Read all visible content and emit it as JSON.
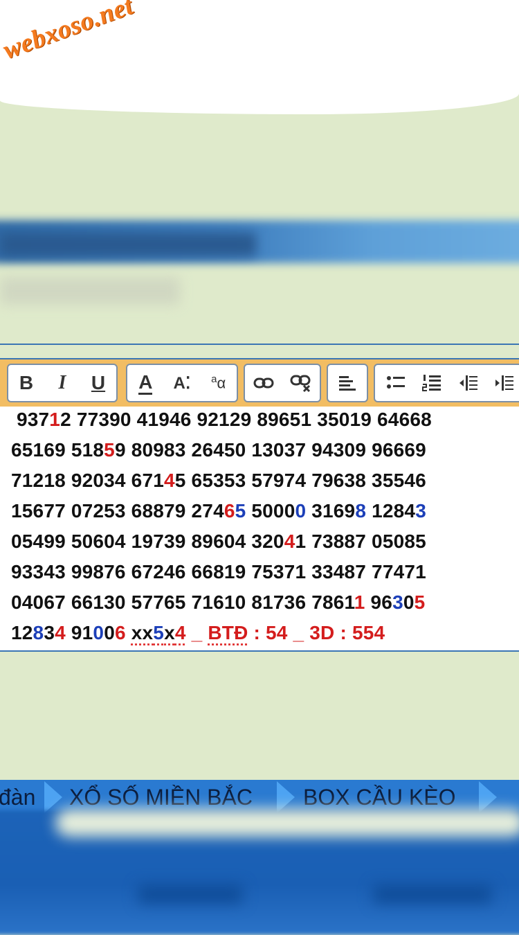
{
  "logo": {
    "text": "webxoso.net"
  },
  "toolbar": {
    "groups": [
      [
        "bold-icon",
        "italic-icon",
        "underline-icon"
      ],
      [
        "font-color-icon",
        "font-size-icon",
        "case-icon"
      ],
      [
        "link-icon",
        "unlink-icon"
      ],
      [
        "align-left-icon"
      ],
      [
        "bullet-list-icon",
        "numbered-list-icon",
        "outdent-icon",
        "indent-icon"
      ]
    ],
    "labels": {
      "bold": "B",
      "italic": "I",
      "underline": "U",
      "font_color": "A",
      "font_size": "A",
      "case": "a"
    }
  },
  "content": {
    "lines": [
      [
        {
          "t": " 937"
        },
        {
          "t": "1",
          "c": "red"
        },
        {
          "t": "2 77390 41946 92129 89651 35019 64668"
        }
      ],
      [
        {
          "t": "65169 518"
        },
        {
          "t": "5",
          "c": "red"
        },
        {
          "t": "9 80983 26450 13037 94309 96669"
        }
      ],
      [
        {
          "t": "71218 92034 671"
        },
        {
          "t": "4",
          "c": "red"
        },
        {
          "t": "5 65353 57974 79638 35546"
        }
      ],
      [
        {
          "t": "15677 07253 68879 274"
        },
        {
          "t": "6",
          "c": "red"
        },
        {
          "t": "5",
          "c": "blue"
        },
        {
          "t": " 5000"
        },
        {
          "t": "0",
          "c": "blue"
        },
        {
          "t": " 3169"
        },
        {
          "t": "8",
          "c": "blue"
        },
        {
          "t": " 1284"
        },
        {
          "t": "3",
          "c": "blue"
        }
      ],
      [
        {
          "t": "05499 50604 19739 89604 320"
        },
        {
          "t": "4",
          "c": "red"
        },
        {
          "t": "1 73887 05085"
        }
      ],
      [
        {
          "t": "93343 99876 67246 66819 75371 33487 77471"
        }
      ],
      [
        {
          "t": "04067 66130 57765 71610 81736 7861"
        },
        {
          "t": "1",
          "c": "red"
        },
        {
          "t": " 96"
        },
        {
          "t": "3",
          "c": "blue"
        },
        {
          "t": "0"
        },
        {
          "t": "5",
          "c": "red"
        }
      ],
      [
        {
          "t": "12"
        },
        {
          "t": "8",
          "c": "blue"
        },
        {
          "t": "3"
        },
        {
          "t": "4",
          "c": "red"
        },
        {
          "t": " 91"
        },
        {
          "t": "0",
          "c": "blue"
        },
        {
          "t": "0"
        },
        {
          "t": "6",
          "c": "red"
        },
        {
          "t": " "
        },
        {
          "t": "xx",
          "s": true
        },
        {
          "t": "5",
          "c": "blue",
          "s": true
        },
        {
          "t": "x",
          "s": true
        },
        {
          "t": "4",
          "c": "red",
          "s": true
        },
        {
          "t": " _ ",
          "c": "red"
        },
        {
          "t": "BTĐ",
          "c": "red",
          "s": true
        },
        {
          "t": " : 54 _ 3D : 554",
          "c": "red"
        }
      ]
    ]
  },
  "nav": {
    "items": [
      {
        "label": "đàn"
      },
      {
        "label": "XỔ SỐ MIỀN BẮC"
      },
      {
        "label": "BOX CẦU KÈO"
      }
    ]
  },
  "colors": {
    "red": "#d41d1d",
    "blue": "#1c3fb8",
    "nav": "#2a7ad1",
    "toolbar": "#f2bd63"
  }
}
